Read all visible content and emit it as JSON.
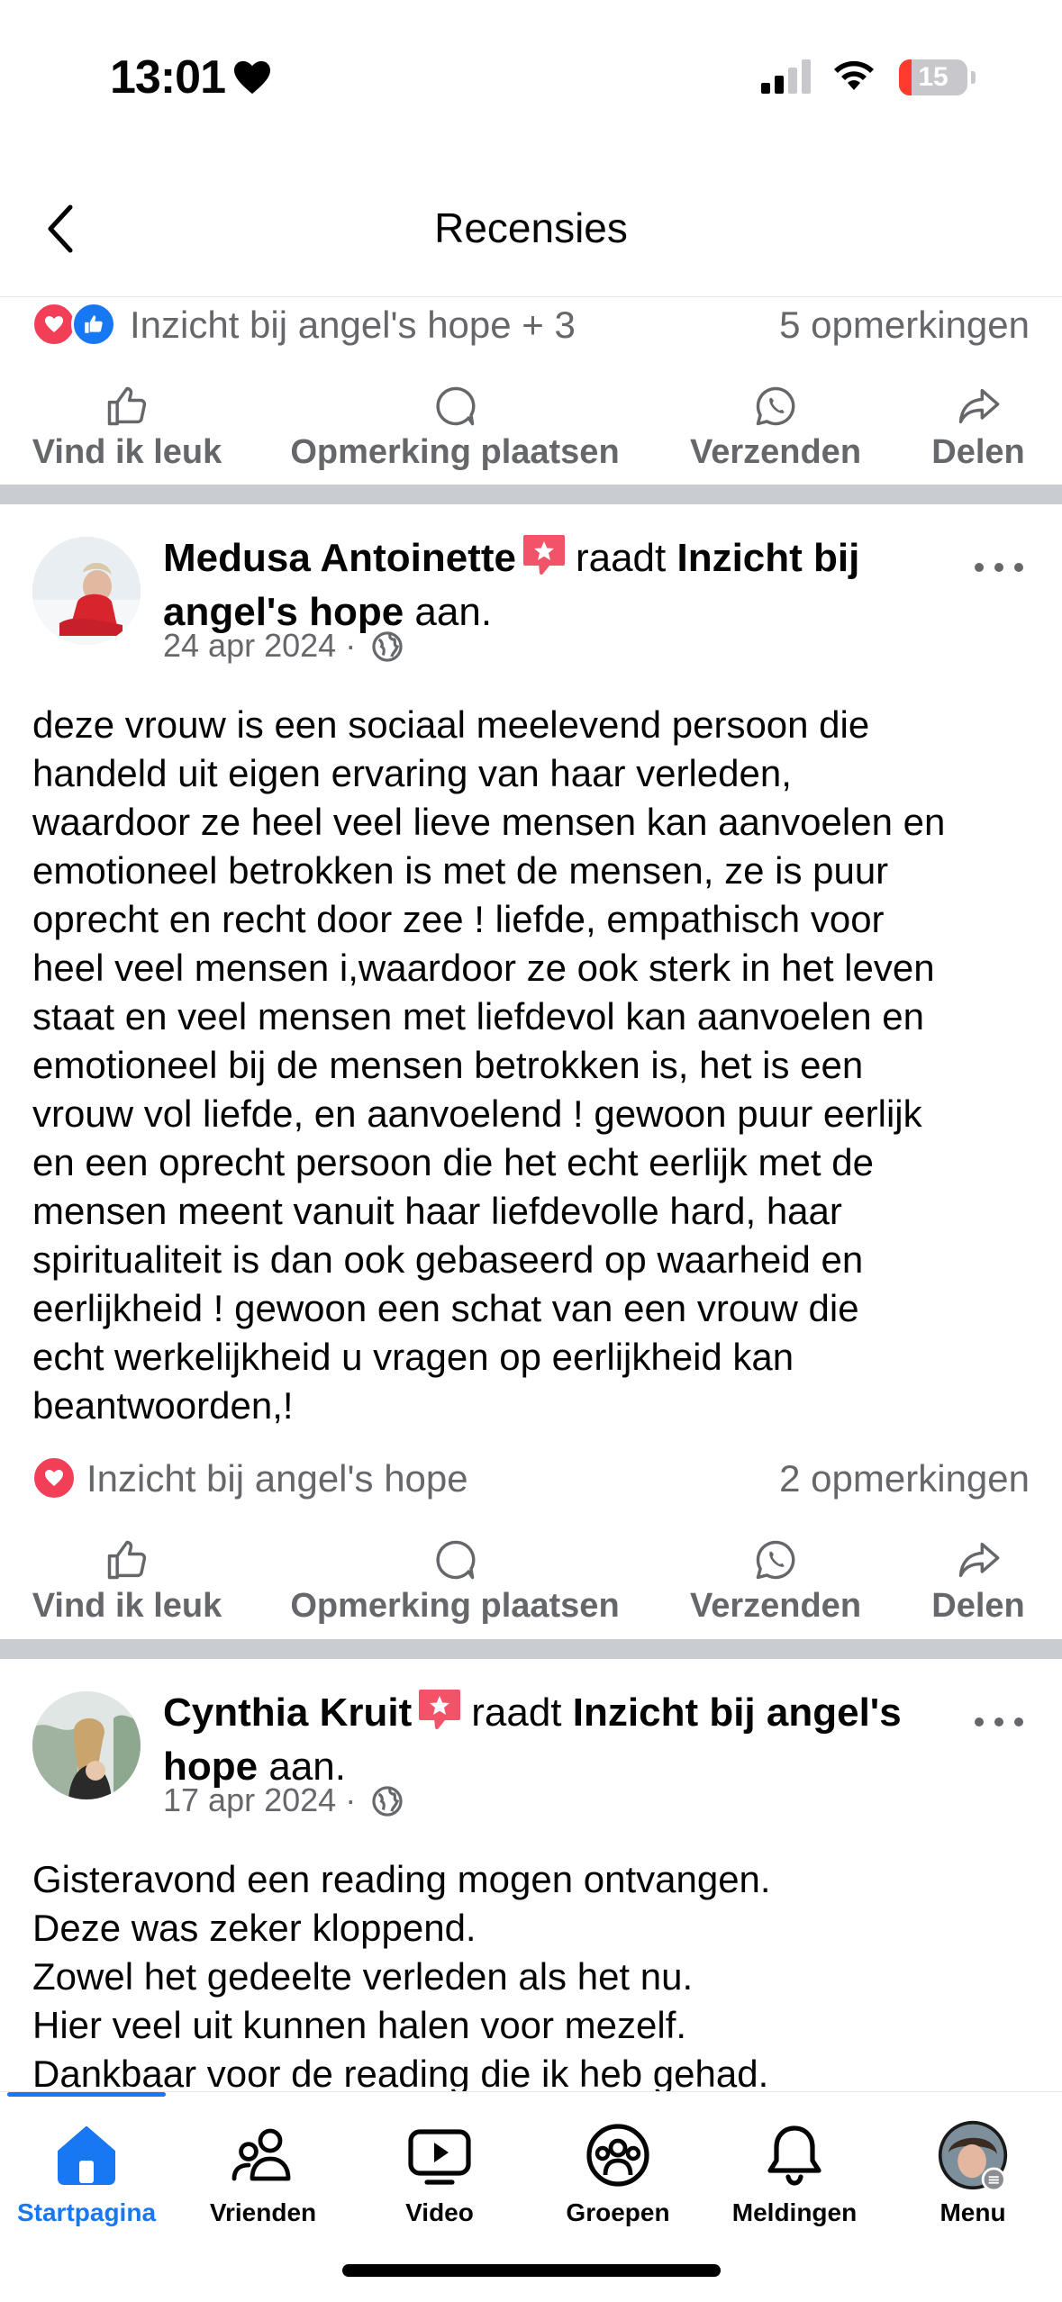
{
  "status_bar": {
    "time": "13:01",
    "battery": "15"
  },
  "header": {
    "title": "Recensies"
  },
  "top_reactions": {
    "text": "Inzicht bij angel's hope + 3",
    "comments": "5 opmerkingen"
  },
  "actions": {
    "like": "Vind ik leuk",
    "comment": "Opmerking plaatsen",
    "send": "Verzenden",
    "share": "Delen"
  },
  "posts": [
    {
      "author": "Medusa Antoinette",
      "verb": "raadt",
      "page": "Inzicht bij angel's hope",
      "suffix": "aan.",
      "date": "24 apr 2024",
      "separator": "·",
      "body": "deze vrouw is een sociaal meelevend persoon die\nhandeld uit eigen ervaring van haar verleden,\nwaardoor ze heel veel lieve mensen kan aanvoelen en\nemotioneel betrokken is met de mensen, ze is puur\noprecht en recht door zee ! liefde, empathisch voor\nheel veel mensen i,waardoor ze ook sterk in het leven\nstaat en veel mensen met liefdevol kan aanvoelen en\nemotioneel bij de mensen betrokken is, het is een\nvrouw vol liefde, en aanvoelend ! gewoon puur eerlijk\nen een oprecht persoon die het echt eerlijk met de\nmensen meent vanuit haar liefdevolle hard, haar\nspiritualiteit is dan ook gebaseerd op waarheid en\neerlijkheid ! gewoon een schat van een vrouw die\necht werkelijkheid u vragen op eerlijkheid kan\nbeantwoorden,!",
      "reactions_text": "Inzicht bij angel's hope",
      "comments": "2 opmerkingen"
    },
    {
      "author": "Cynthia Kruit",
      "verb": "raadt",
      "page_part1": "Inzicht bij angel's",
      "page_part2": "hope",
      "suffix": "aan.",
      "date": "17 apr 2024",
      "separator": "·",
      "body": "Gisteravond een reading mogen ontvangen.\nDeze was zeker kloppend.\nZowel het gedeelte verleden als het nu.\nHier veel uit kunnen halen voor mezelf.\nDankbaar voor de reading die ik heb gehad."
    }
  ],
  "nav": {
    "home": "Startpagina",
    "friends": "Vrienden",
    "video": "Video",
    "groups": "Groepen",
    "notifications": "Meldingen",
    "menu": "Menu"
  },
  "colors": {
    "accent": "#1877f2",
    "love": "#f33e58",
    "secondary_text": "#65676b",
    "divider": "#c9ccd1"
  },
  "icons": [
    "heart-icon",
    "signal-icon",
    "wifi-icon",
    "back-icon",
    "thumbs-up-icon",
    "comment-icon",
    "whatsapp-icon",
    "share-icon",
    "more-icon",
    "star-badge-icon",
    "globe-icon",
    "home-icon",
    "friends-icon",
    "video-icon",
    "groups-icon",
    "bell-icon"
  ]
}
